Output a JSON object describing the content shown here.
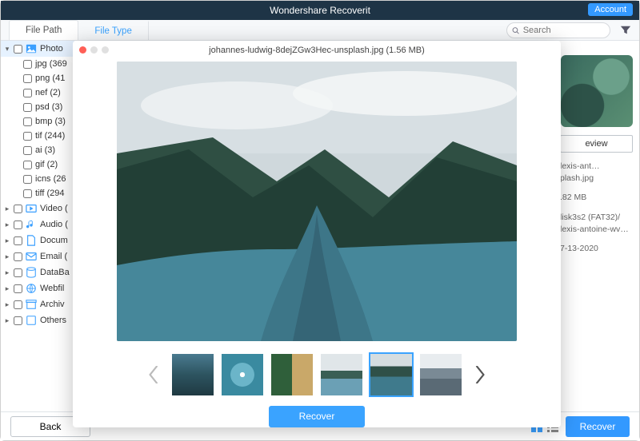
{
  "app": {
    "title": "Wondershare Recoverit",
    "account_label": "Account"
  },
  "tabs": {
    "file_path": "File Path",
    "file_type": "File Type"
  },
  "search": {
    "placeholder": "Search"
  },
  "sidebar": {
    "categories": [
      {
        "label": "Photo",
        "icon": "image-icon"
      },
      {
        "label": "Video (",
        "icon": "video-icon"
      },
      {
        "label": "Audio (",
        "icon": "audio-icon"
      },
      {
        "label": "Docum",
        "icon": "document-icon"
      },
      {
        "label": "Email (",
        "icon": "email-icon"
      },
      {
        "label": "DataBa",
        "icon": "database-icon"
      },
      {
        "label": "Webfil",
        "icon": "web-icon"
      },
      {
        "label": "Archiv",
        "icon": "archive-icon"
      },
      {
        "label": "Others",
        "icon": "others-icon"
      }
    ],
    "photo_children": [
      {
        "label": "jpg (369"
      },
      {
        "label": "png (41"
      },
      {
        "label": "nef (2)"
      },
      {
        "label": "psd (3)"
      },
      {
        "label": "bmp (3)"
      },
      {
        "label": "tif (244)"
      },
      {
        "label": "ai (3)"
      },
      {
        "label": "gif (2)"
      },
      {
        "label": "icns (26"
      },
      {
        "label": "tiff (294"
      }
    ]
  },
  "preview": {
    "filename": "johannes-ludwig-8dejZGw3Hec-unsplash.jpg (1.56 MB)",
    "recover_label": "Recover"
  },
  "right": {
    "review_label": "eview",
    "filename": "lexis-ant…plash.jpg",
    "size": ".82 MB",
    "path1": "lisk3s2 (FAT32)/",
    "path2": "lexis-antoine-wv…",
    "date": "7-13-2020"
  },
  "bottom": {
    "back_label": "Back",
    "recover_label": "Recover"
  }
}
